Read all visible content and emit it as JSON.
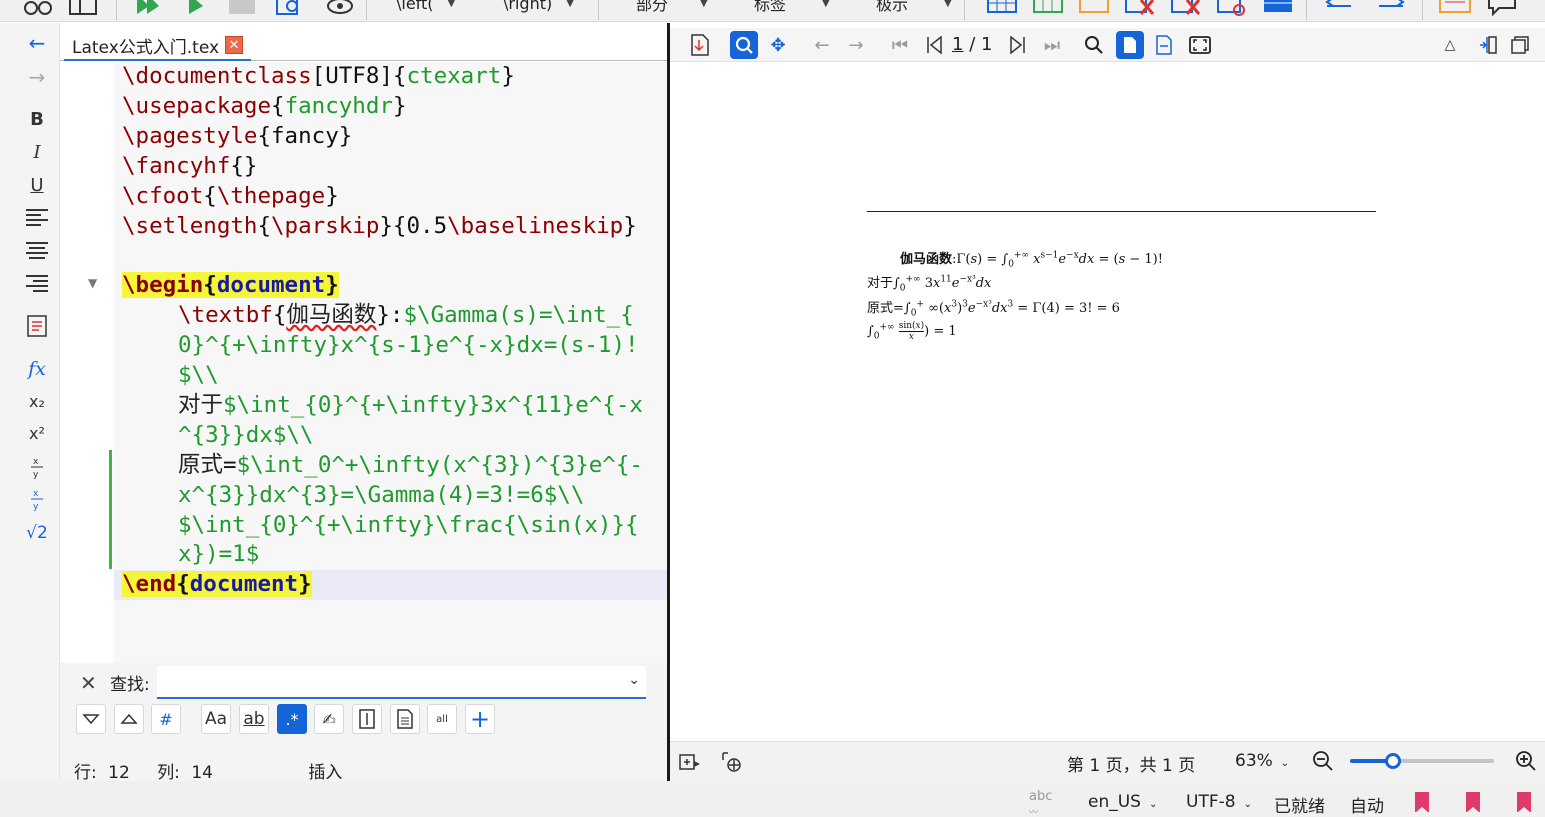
{
  "top_toolbar": {
    "dropdowns": [
      "\\left(",
      "\\right)",
      "部分",
      "标签",
      "极示"
    ]
  },
  "left_toolbar": {
    "bold": "B",
    "italic": "I",
    "underline": "U",
    "fx": "fx",
    "subscript": "x₂",
    "superscript": "x²",
    "frac": "x/y",
    "dfrac": "x/y",
    "sqrt": "√2"
  },
  "editor": {
    "tab_title": "Latex公式入门.tex",
    "tab_close": "✕",
    "lines": [
      "\\documentclass[UTF8]{ctexart}",
      "\\usepackage{fancyhdr}",
      "\\pagestyle{fancy}",
      "\\fancyhf{}",
      "\\cfoot{\\thepage}",
      "\\setlength{\\parskip}{0.5\\baselineskip}",
      "",
      "\\begin{document}",
      "    \\textbf{伽马函数}:$\\Gamma(s)=\\int_{0}^{+\\infty}x^{s-1}e^{-x}dx=(s-1)!$\\\\",
      "    对于$\\int_{0}^{+\\infty}3x^{11}e^{-x^{3}}dx$\\\\",
      "    原式=$\\int_0^+\\infty(x^{3})^{3}e^{-x^{3}}dx^{3}=\\Gamma(4)=3!=6$\\\\",
      "    $\\int_{0}^{+\\infty}\\frac{\\sin(x)}{x})=1$",
      "\\end{document}"
    ],
    "segments": {
      "l0a": "\\documentclass",
      "l0b": "[UTF8]{",
      "l0c": "ctexart",
      "l0d": "}",
      "l1a": "\\usepackage",
      "l1b": "{",
      "l1c": "fancyhdr",
      "l1d": "}",
      "l2a": "\\pagestyle",
      "l2b": "{fancy}",
      "l3a": "\\fancyhf",
      "l3b": "{}",
      "l4a": "\\cfoot",
      "l4b": "{",
      "l4c": "\\thepage",
      "l4d": "}",
      "l5a": "\\setlength",
      "l5b": "{",
      "l5c": "\\parskip",
      "l5d": "}{0.5",
      "l5e": "\\baselineskip",
      "l5f": "}",
      "l7a": "\\begin",
      "l7b": "{",
      "l7c": "document",
      "l7d": "}",
      "l8a": "\\textbf",
      "l8b": "{",
      "l8c": "伽马函数",
      "l8d": "}:",
      "l8e": "$\\Gamma(s)=\\int_{",
      "l9a": "0}^{+\\infty}x^{s-1}e^{-x}dx=(s-1)!",
      "l10a": "$\\\\",
      "l11a": "对于",
      "l11b": "$\\int_{0}^{+\\infty}3x^{11}e^{-x",
      "l12a": "^{3}}dx$\\\\",
      "l13a": "原式",
      "l13b": "=",
      "l13c": "$\\int_0^+\\infty(x^{3})^{3}e^{-",
      "l14a": "x^{3}}dx^{3}=\\Gamma(4)=3!=6$\\\\",
      "l15a": "$\\int_{0}^{+\\infty}\\frac{\\sin(x)}{",
      "l16a": "x})=1$",
      "l17a": "\\end",
      "l17b": "{",
      "l17c": "document",
      "l17d": "}"
    }
  },
  "search": {
    "label": "查找:",
    "value": "",
    "buttons": [
      "Aa",
      "ab",
      ".*",
      "all"
    ]
  },
  "cursor_status": {
    "row_label": "行:",
    "row": "12",
    "col_label": "列:",
    "col": "14",
    "mode": "插入"
  },
  "pdf": {
    "page_current": "1",
    "page_total": "/ 1",
    "line1_label": "伽马函数",
    "line2_label": "对于",
    "line3_label": "原式=",
    "page_count": "第 1 页，共 1 页",
    "zoom": "63%",
    "zoom_fraction": 0.3
  },
  "app_status": {
    "language": "en_US",
    "encoding": "UTF-8",
    "ready": "已就绪",
    "auto": "自动"
  },
  "colors": {
    "accent": "#1565d8",
    "keyword": "#8b0000",
    "math": "#1e9a2f",
    "highlight": "#f5f53a"
  }
}
